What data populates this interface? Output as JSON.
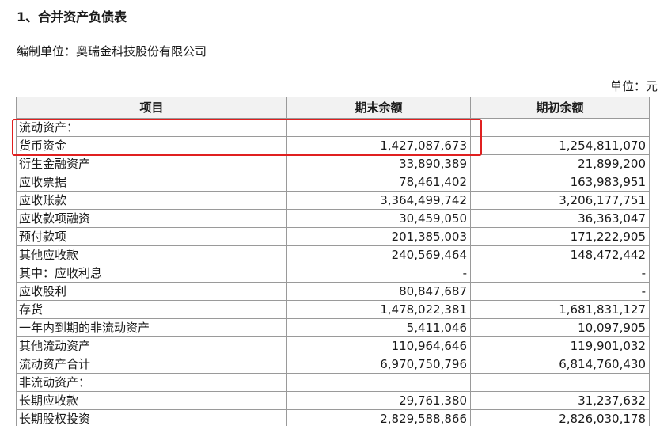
{
  "title": "1、合并资产负债表",
  "company_line": "编制单位：奥瑞金科技股份有限公司",
  "unit": "单位：元",
  "columns": [
    "项目",
    "期末余额",
    "期初余额"
  ],
  "rows": [
    {
      "item": "流动资产：",
      "end": "",
      "begin": ""
    },
    {
      "item": "货币资金",
      "end": "1,427,087,673",
      "begin": "1,254,811,070"
    },
    {
      "item": "衍生金融资产",
      "end": "33,890,389",
      "begin": "21,899,200"
    },
    {
      "item": "应收票据",
      "end": "78,461,402",
      "begin": "163,983,951"
    },
    {
      "item": "应收账款",
      "end": "3,364,499,742",
      "begin": "3,206,177,751"
    },
    {
      "item": "应收款项融资",
      "end": "30,459,050",
      "begin": "36,363,047"
    },
    {
      "item": "预付款项",
      "end": "201,385,003",
      "begin": "171,222,905"
    },
    {
      "item": "其他应收款",
      "end": "240,569,464",
      "begin": "148,472,442"
    },
    {
      "item": "其中：应收利息",
      "end": "-",
      "begin": "-"
    },
    {
      "item": "应收股利",
      "end": "80,847,687",
      "begin": "-"
    },
    {
      "item": "存货",
      "end": "1,478,022,381",
      "begin": "1,681,831,127"
    },
    {
      "item": "一年内到期的非流动资产",
      "end": "5,411,046",
      "begin": "10,097,905"
    },
    {
      "item": "其他流动资产",
      "end": "110,964,646",
      "begin": "119,901,032"
    },
    {
      "item": "流动资产合计",
      "end": "6,970,750,796",
      "begin": "6,814,760,430"
    },
    {
      "item": "非流动资产：",
      "end": "",
      "begin": ""
    },
    {
      "item": "长期应收款",
      "end": "29,761,380",
      "begin": "31,237,632"
    },
    {
      "item": "长期股权投资",
      "end": "2,829,588,866",
      "begin": "2,826,030,178"
    }
  ],
  "colors": {
    "highlight": "#e02020",
    "header_bg": "#f2f2f2",
    "border": "#9a9a9a"
  }
}
